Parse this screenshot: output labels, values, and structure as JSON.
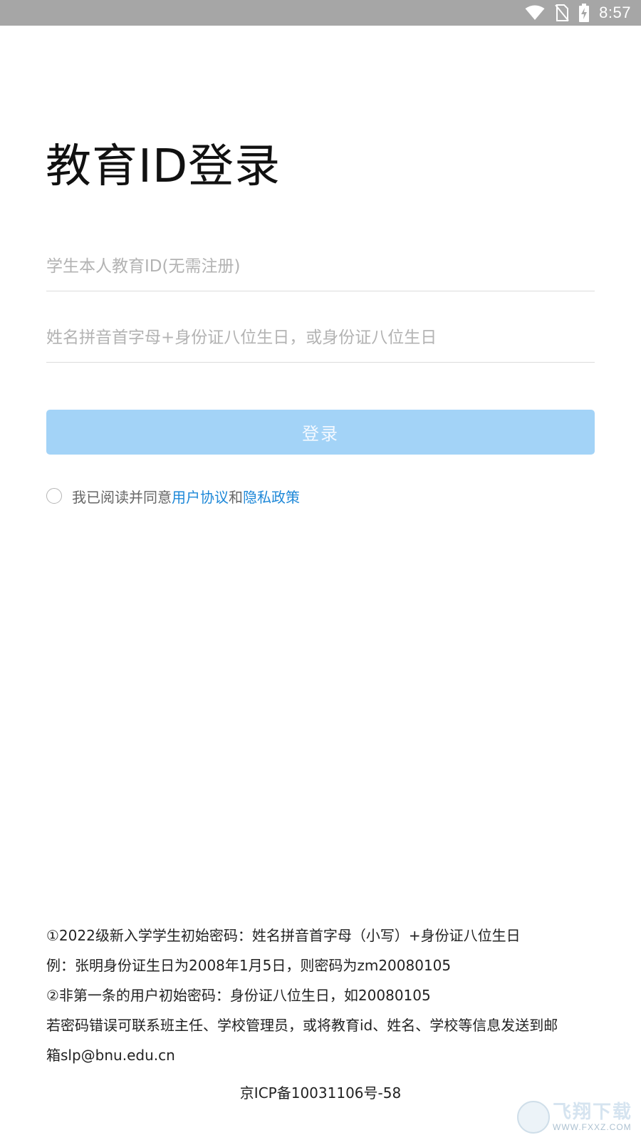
{
  "status_bar": {
    "time": "8:57",
    "icons": [
      "wifi-icon",
      "no-sim-icon",
      "battery-charging-icon"
    ]
  },
  "title": "教育ID登录",
  "form": {
    "id_placeholder": "学生本人教育ID(无需注册)",
    "password_placeholder": "姓名拼音首字母+身份证八位生日，或身份证八位生日",
    "login_label": "登录",
    "login_button_color": "#a3d3f7"
  },
  "agreement": {
    "prefix": "我已阅读并同意",
    "user_agreement": "用户协议",
    "conjunction": "和",
    "privacy_policy": "隐私政策",
    "link_color": "#1e88d8"
  },
  "notes": [
    "①2022级新入学学生初始密码：姓名拼音首字母（小写）+身份证八位生日",
    "例：张明身份证生日为2008年1月5日，则密码为zm20080105",
    "②非第一条的用户初始密码：身份证八位生日，如20080105",
    "若密码错误可联系班主任、学校管理员，或将教育id、姓名、学校等信息发送到邮",
    "箱slp@bnu.edu.cn"
  ],
  "icp": "京ICP备10031106号-58",
  "watermark": {
    "main": "飞翔下载",
    "sub": "WWW.FXXZ.COM"
  }
}
